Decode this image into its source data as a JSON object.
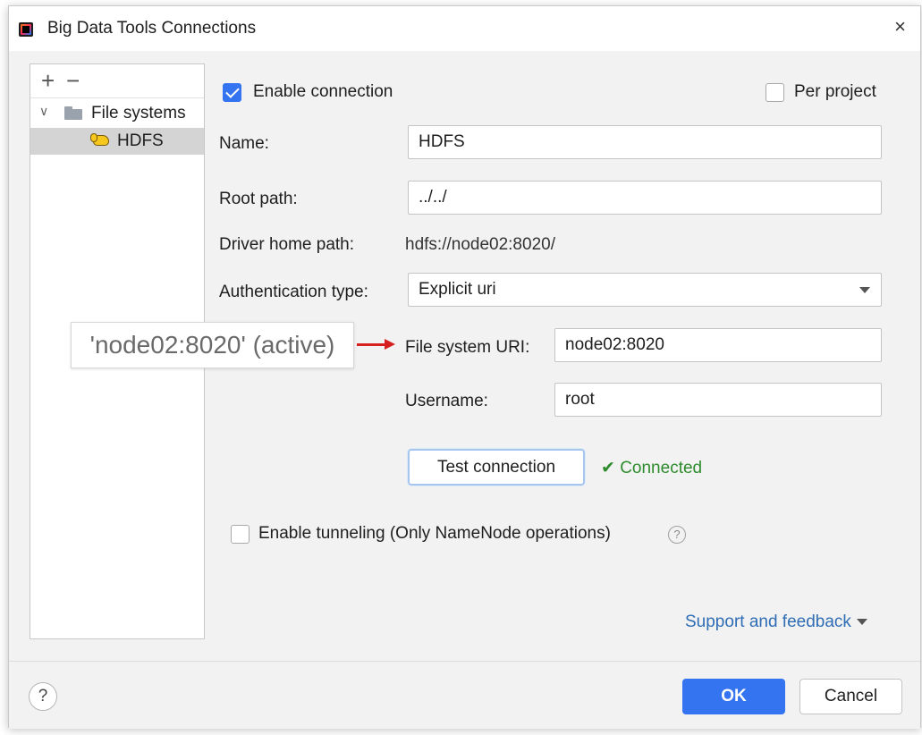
{
  "window": {
    "title": "Big Data Tools Connections",
    "close_symbol": "×",
    "app_icon": "intellij-app-icon"
  },
  "tree": {
    "add_symbol": "+",
    "remove_symbol": "−",
    "group": {
      "label": "File systems",
      "expanded": true,
      "icon": "folder-icon"
    },
    "items": [
      {
        "label": "HDFS",
        "icon": "hdfs-elephant-icon",
        "selected": true
      }
    ]
  },
  "form": {
    "enable_connection": {
      "label": "Enable connection",
      "checked": true
    },
    "per_project": {
      "label": "Per project",
      "checked": false
    },
    "name": {
      "label": "Name:",
      "value": "HDFS"
    },
    "root_path": {
      "label": "Root path:",
      "value": "../../"
    },
    "driver_home_path": {
      "label": "Driver home path:",
      "value": "hdfs://node02:8020/"
    },
    "auth_type": {
      "label": "Authentication type:",
      "value": "Explicit uri"
    },
    "file_system_uri": {
      "label": "File system URI:",
      "value": "node02:8020"
    },
    "username": {
      "label": "Username:",
      "value": "root"
    },
    "test_button": "Test connection",
    "status": {
      "icon": "check-icon",
      "symbol": "✔",
      "text": "Connected",
      "color": "#2e8c2e"
    },
    "enable_tunneling": {
      "label": "Enable tunneling (Only NameNode operations)",
      "checked": false
    },
    "tunneling_help": "?",
    "support_link": "Support and feedback"
  },
  "annotation": {
    "text": "'node02:8020' (active)",
    "arrow_color": "#d61f1f"
  },
  "footer": {
    "help_symbol": "?",
    "ok_label": "OK",
    "cancel_label": "Cancel",
    "accent": "#3574f0"
  }
}
